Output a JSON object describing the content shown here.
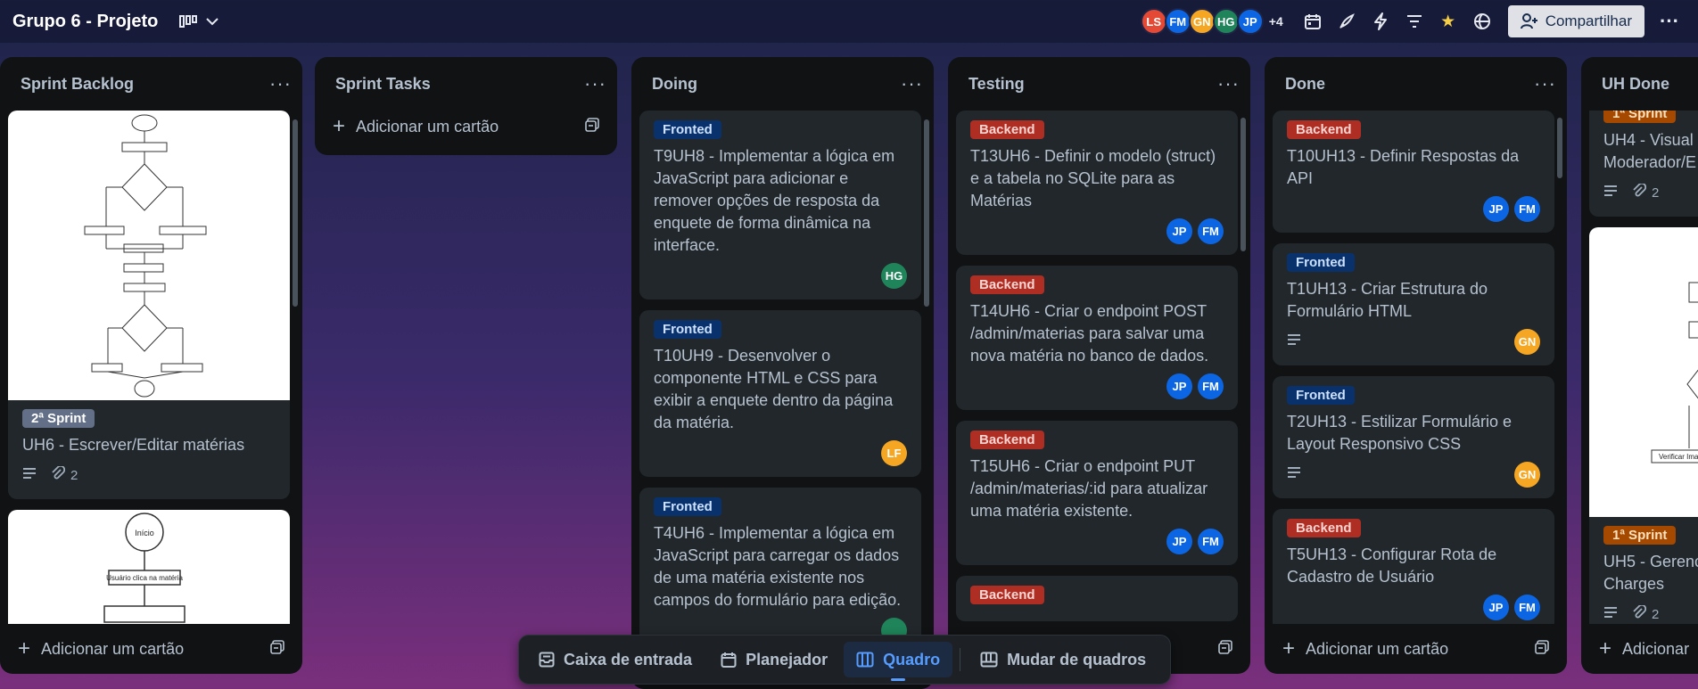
{
  "header": {
    "board_title": "Grupo 6 - Projeto",
    "members": [
      {
        "initials": "LS",
        "color": "#e34935"
      },
      {
        "initials": "FM",
        "color": "#0c66e4"
      },
      {
        "initials": "GN",
        "color": "#f5a623"
      },
      {
        "initials": "HG",
        "color": "#1f845a"
      },
      {
        "initials": "JP",
        "color": "#0c66e4"
      }
    ],
    "more_members": "+4",
    "icons": [
      "calendar-icon",
      "automation-icon",
      "power-ups-icon",
      "filter-icon",
      "star-icon",
      "globe-icon"
    ],
    "share_label": "Compartilhar"
  },
  "lists": [
    {
      "title": "Sprint Backlog",
      "add_label": "Adicionar um cartão",
      "cards": [
        {
          "label": "2ª Sprint",
          "title": "UH6 - Escrever/Editar matérias",
          "attachments": "2"
        },
        {
          "cover_texts": [
            "Início",
            "Usuário clica na matéria"
          ]
        }
      ]
    },
    {
      "title": "Sprint Tasks",
      "add_label": "Adicionar um cartão"
    },
    {
      "title": "Doing",
      "cards": [
        {
          "label": "Fronted",
          "title": "T9UH8 - Implementar a lógica em JavaScript para adicionar e remover opções de resposta da enquete de forma dinâmica na interface.",
          "members": [
            "HG"
          ]
        },
        {
          "label": "Fronted",
          "title": "T10UH9 - Desenvolver o componente HTML e CSS para exibir a enquete dentro da página da matéria.",
          "members": [
            "LF"
          ]
        },
        {
          "label": "Fronted",
          "title": "T4UH6 - Implementar a lógica em JavaScript para carregar os dados de uma matéria existente nos campos do formulário para edição."
        }
      ]
    },
    {
      "title": "Testing",
      "cards": [
        {
          "label": "Backend",
          "title": "T13UH6 - Definir o modelo (struct) e a tabela no SQLite para as Matérias",
          "members": [
            "JP",
            "FM"
          ]
        },
        {
          "label": "Backend",
          "title": "T14UH6 - Criar o endpoint POST /admin/materias para salvar uma nova matéria no banco de dados.",
          "members": [
            "JP",
            "FM"
          ]
        },
        {
          "label": "Backend",
          "title": "T15UH6 - Criar o endpoint PUT /admin/materias/:id para atualizar uma matéria existente.",
          "members": [
            "JP",
            "FM"
          ]
        },
        {
          "label": "Backend"
        }
      ]
    },
    {
      "title": "Done",
      "add_label": "Adicionar um cartão",
      "cards": [
        {
          "label": "Backend",
          "title": "T10UH13 - Definir Respostas da API",
          "members": [
            "JP",
            "FM"
          ]
        },
        {
          "label": "Fronted",
          "title": "T1UH13 - Criar Estrutura do Formulário HTML",
          "members": [
            "GN"
          ]
        },
        {
          "label": "Fronted",
          "title": "T2UH13 - Estilizar Formulário e Layout Responsivo CSS",
          "members": [
            "GN"
          ]
        },
        {
          "label": "Backend",
          "title": "T5UH13 - Configurar Rota de Cadastro de Usuário",
          "members": [
            "JP",
            "FM"
          ]
        }
      ]
    },
    {
      "title": "UH Done",
      "add_label": "Adicionar",
      "cards": [
        {
          "label": "1ª Sprint",
          "title": "UH4 - Visual Moderador/E",
          "attachments": "2"
        },
        {
          "cover_texts": [
            "Verificar Imagem"
          ],
          "label": "1ª Sprint",
          "title": "UH5 - Gerenc Charges",
          "attachments": "2"
        }
      ]
    }
  ],
  "member_colors": {
    "HG": "#1f845a",
    "LF": "#f5a623",
    "JP": "#0c66e4",
    "FM": "#0c66e4",
    "GN": "#f5a623"
  },
  "bottom_nav": {
    "inbox": "Caixa de entrada",
    "planner": "Planejador",
    "board": "Quadro",
    "switch_boards": "Mudar de quadros"
  }
}
